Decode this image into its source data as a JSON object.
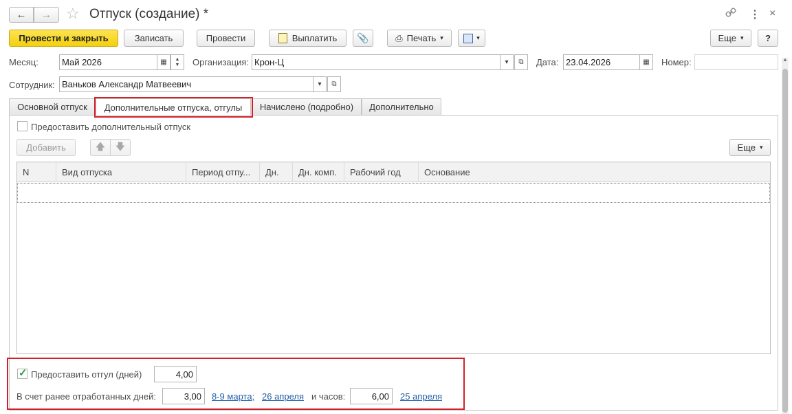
{
  "window": {
    "title": "Отпуск (создание) *"
  },
  "toolbar": {
    "post_and_close": "Провести и закрыть",
    "save": "Записать",
    "post": "Провести",
    "pay": "Выплатить",
    "print": "Печать",
    "more": "Еще",
    "help": "?"
  },
  "header": {
    "month_label": "Месяц:",
    "month_value": "Май 2026",
    "org_label": "Организация:",
    "org_value": "Крон-Ц",
    "date_label": "Дата:",
    "date_value": "23.04.2026",
    "number_label": "Номер:",
    "number_value": "",
    "employee_label": "Сотрудник:",
    "employee_value": "Ваньков Александр Матвеевич"
  },
  "tabs": [
    {
      "label": "Основной отпуск"
    },
    {
      "label": "Дополнительные отпуска, отгулы"
    },
    {
      "label": "Начислено (подробно)"
    },
    {
      "label": "Дополнительно"
    }
  ],
  "extra": {
    "provide_extra_label": "Предоставить дополнительный отпуск",
    "provide_extra_checked": false,
    "add_button": "Добавить",
    "more": "Еще",
    "columns": [
      "N",
      "Вид отпуска",
      "Период отпу...",
      "Дн.",
      "Дн. комп.",
      "Рабочий год",
      "Основание"
    ]
  },
  "dayoff": {
    "provide_label": "Предоставить отгул (дней)",
    "provide_checked": true,
    "provide_value": "4,00",
    "worked_label": "В счет ранее отработанных дней:",
    "worked_value": "3,00",
    "worked_link1": "8-9 марта;",
    "worked_link2": "26 апреля",
    "hours_label": "и часов:",
    "hours_value": "6,00",
    "hours_link": "25 апреля"
  },
  "colors": {
    "accent_yellow": "#f5d00e",
    "highlight_red": "#d0202a",
    "link_blue": "#1f5fa8",
    "check_green": "#2e9b3a"
  }
}
